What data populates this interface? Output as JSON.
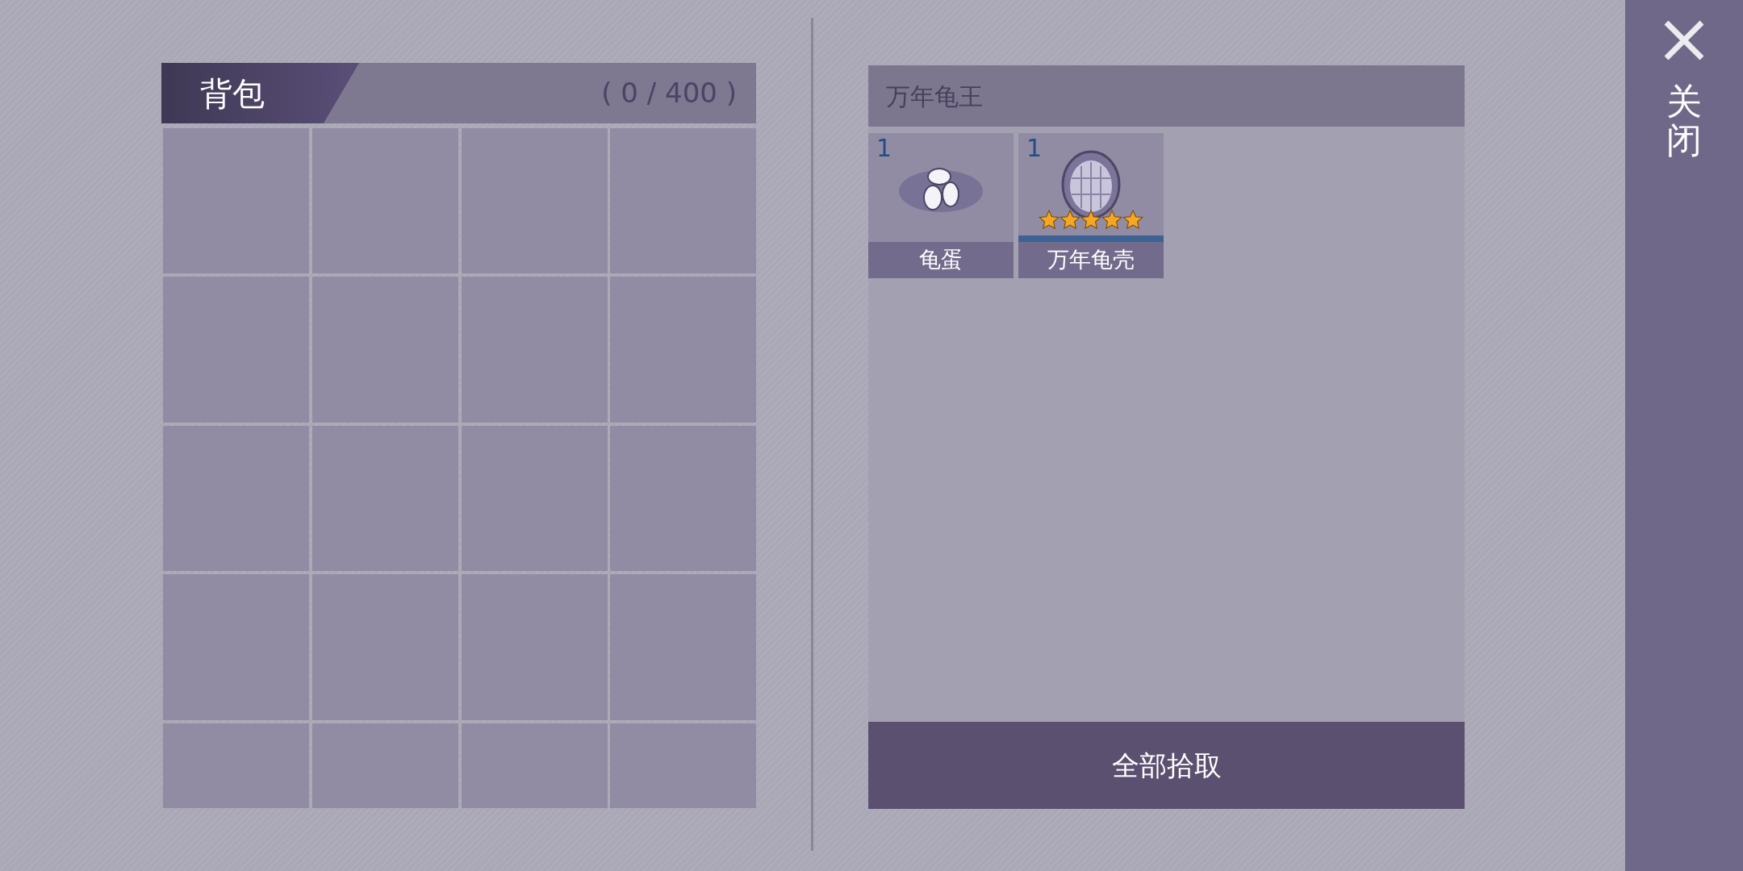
{
  "bag": {
    "title": "背包",
    "count": "( 0 / 400 )"
  },
  "loot": {
    "title": "万年龟王",
    "items": [
      {
        "kind": "egg",
        "count": "1",
        "name": "龟蛋"
      },
      {
        "kind": "shell",
        "count": "1",
        "name": "万年龟壳",
        "stars": 5
      }
    ],
    "button": "全部拾取"
  },
  "close": {
    "label": "关闭"
  }
}
